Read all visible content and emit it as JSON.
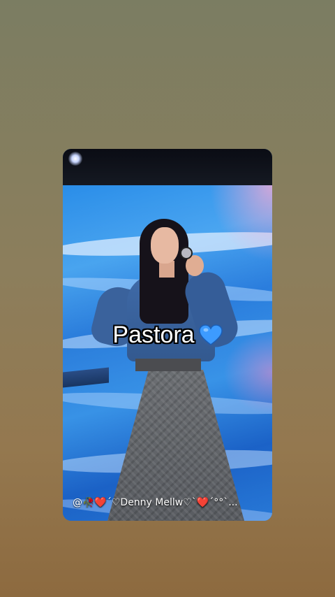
{
  "story": {
    "caption": "Pastora",
    "caption_icon": "blue-heart-icon",
    "username": "@🥀❤️´♡Denny Mellw♡`❤️´°°`...",
    "colors": {
      "background_top": "#7b7d62",
      "background_bottom": "#8d6a3f",
      "stage_blue": "#2a8de8",
      "heart_blue": "#3d9bff"
    }
  }
}
